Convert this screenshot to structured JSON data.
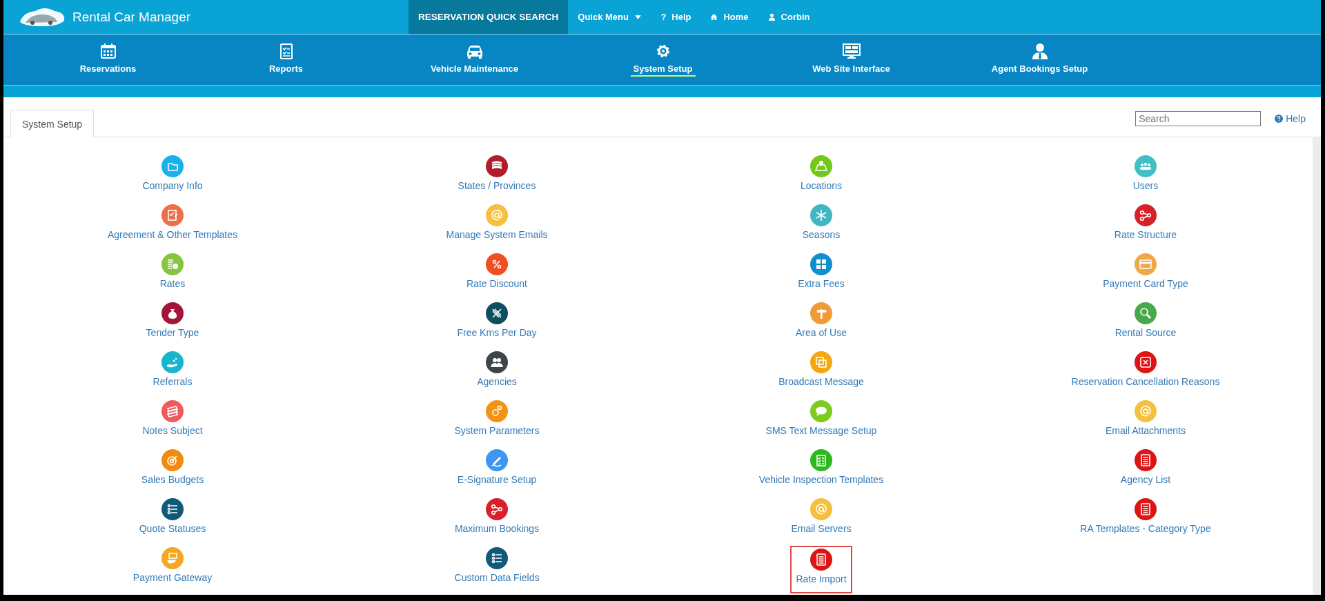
{
  "app": {
    "title": "Rental Car Manager"
  },
  "top_menu": [
    {
      "label": "RESERVATION QUICK SEARCH",
      "kind": "block"
    },
    {
      "label": "Quick Menu",
      "kind": "dropdown"
    },
    {
      "label": "Help",
      "kind": "help",
      "glyph": "?"
    },
    {
      "label": "Home",
      "kind": "home"
    },
    {
      "label": "Corbin",
      "kind": "user"
    }
  ],
  "nav": [
    {
      "label": "Reservations",
      "kind": "calendar",
      "selected": false
    },
    {
      "label": "Reports",
      "kind": "checklist",
      "selected": false
    },
    {
      "label": "Vehicle Maintenance",
      "kind": "car",
      "selected": false
    },
    {
      "label": "System Setup",
      "kind": "gear",
      "selected": true
    },
    {
      "label": "Web Site Interface",
      "kind": "monitor",
      "selected": false
    },
    {
      "label": "Agent Bookings Setup",
      "kind": "agent",
      "selected": false
    }
  ],
  "tabs": [
    {
      "label": "System Setup",
      "selected": true
    }
  ],
  "search": {
    "placeholder": "Search"
  },
  "help_link": "Help",
  "setup_columns": [
    [
      {
        "label": "Company Info",
        "kind": "folder",
        "color": "#1ab0ea",
        "highlighted": false
      },
      {
        "label": "Agreement & Other Templates",
        "kind": "checklist",
        "color": "#ee6e48",
        "highlighted": false
      },
      {
        "label": "Rates",
        "kind": "coins",
        "color": "#86c53c",
        "highlighted": false
      },
      {
        "label": "Tender Type",
        "kind": "moneybag",
        "color": "#a3153a",
        "highlighted": false
      },
      {
        "label": "Referrals",
        "kind": "hand",
        "color": "#17b6cc",
        "highlighted": false
      },
      {
        "label": "Notes Subject",
        "kind": "notes",
        "color": "#ef5a5a",
        "highlighted": false
      },
      {
        "label": "Sales Budgets",
        "kind": "target",
        "color": "#f28a10",
        "highlighted": false
      },
      {
        "label": "Quote Statuses",
        "kind": "list",
        "color": "#0f5a78",
        "highlighted": false
      },
      {
        "label": "Payment Gateway",
        "kind": "card",
        "color": "#f5a623",
        "highlighted": false
      }
    ],
    [
      {
        "label": "States / Provinces",
        "kind": "flag",
        "color": "#b31c2c",
        "highlighted": false
      },
      {
        "label": "Manage System Emails",
        "kind": "at",
        "color": "#f5c040",
        "highlighted": false
      },
      {
        "label": "Rate Discount",
        "kind": "percent",
        "color": "#f04e23",
        "highlighted": false
      },
      {
        "label": "Free Kms Per Day",
        "kind": "cross",
        "color": "#0d4f5e",
        "highlighted": false
      },
      {
        "label": "Agencies",
        "kind": "people",
        "color": "#3d4549",
        "highlighted": false
      },
      {
        "label": "System Parameters",
        "kind": "gears",
        "color": "#f39314",
        "highlighted": false
      },
      {
        "label": "E-Signature Setup",
        "kind": "pen",
        "color": "#3b97f0",
        "highlighted": false
      },
      {
        "label": "Maximum Bookings",
        "kind": "share",
        "color": "#d8202a",
        "highlighted": false
      },
      {
        "label": "Custom Data Fields",
        "kind": "list",
        "color": "#0f5a78",
        "highlighted": false
      }
    ],
    [
      {
        "label": "Locations",
        "kind": "map",
        "color": "#74c81c",
        "highlighted": false
      },
      {
        "label": "Seasons",
        "kind": "snowflake",
        "color": "#40b7c0",
        "highlighted": false
      },
      {
        "label": "Extra Fees",
        "kind": "calculator",
        "color": "#0f8fd0",
        "highlighted": false
      },
      {
        "label": "Area of Use",
        "kind": "signpost",
        "color": "#f09a38",
        "highlighted": false
      },
      {
        "label": "Broadcast Message",
        "kind": "squares",
        "color": "#f5a60f",
        "highlighted": false
      },
      {
        "label": "SMS Text Message Setup",
        "kind": "sms",
        "color": "#7ccc1e",
        "highlighted": false
      },
      {
        "label": "Vehicle Inspection Templates",
        "kind": "clipboard",
        "color": "#2eb81e",
        "highlighted": false
      },
      {
        "label": "Email Servers",
        "kind": "at",
        "color": "#f5c040",
        "highlighted": false
      },
      {
        "label": "Rate Import",
        "kind": "document",
        "color": "#dc1414",
        "highlighted": true
      }
    ],
    [
      {
        "label": "Users",
        "kind": "users",
        "color": "#40bfc4",
        "highlighted": false
      },
      {
        "label": "Rate Structure",
        "kind": "share",
        "color": "#d8202a",
        "highlighted": false
      },
      {
        "label": "Payment Card Type",
        "kind": "creditcard",
        "color": "#f0a848",
        "highlighted": false
      },
      {
        "label": "Rental Source",
        "kind": "search",
        "color": "#48a84a",
        "highlighted": false
      },
      {
        "label": "Reservation Cancellation Reasons",
        "kind": "xbox",
        "color": "#dc1414",
        "highlighted": false
      },
      {
        "label": "Email Attachments",
        "kind": "at",
        "color": "#f5c040",
        "highlighted": false
      },
      {
        "label": "Agency List",
        "kind": "document",
        "color": "#dc1414",
        "highlighted": false
      },
      {
        "label": "RA Templates - Category Type",
        "kind": "document",
        "color": "#dc1414",
        "highlighted": false
      }
    ]
  ]
}
